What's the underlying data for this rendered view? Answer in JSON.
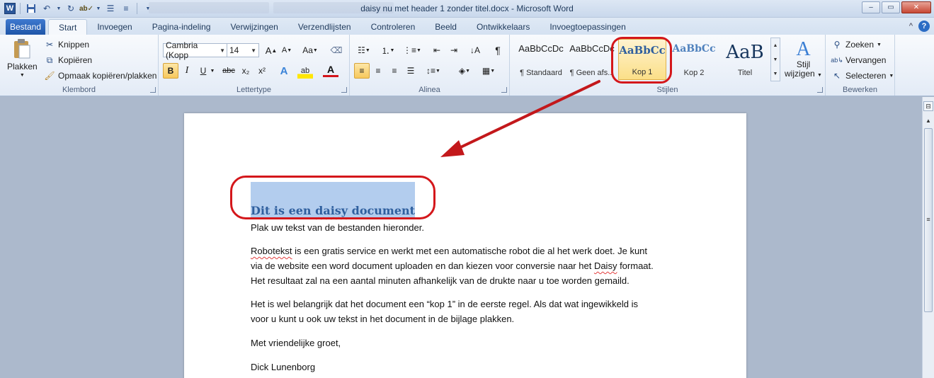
{
  "window": {
    "title": "daisy nu met header 1 zonder titel.docx  -  Microsoft Word",
    "min_symbol": "–",
    "max_symbol": "▭",
    "close_symbol": "✕"
  },
  "qat": {
    "logo": "W",
    "save_icon": "floppy-icon",
    "undo_icon": "undo-icon",
    "redo_icon": "redo-icon",
    "spell_icon": "spellcheck-icon"
  },
  "tabs": {
    "file": "Bestand",
    "items": [
      "Start",
      "Invoegen",
      "Pagina-indeling",
      "Verwijzingen",
      "Verzendlijsten",
      "Controleren",
      "Beeld",
      "Ontwikkelaars",
      "Invoegtoepassingen"
    ],
    "help": "?",
    "collapse": "^"
  },
  "clipboard": {
    "paste": "Plakken",
    "cut": "Knippen",
    "copy": "Kopiëren",
    "format_painter": "Opmaak kopiëren/plakken",
    "label": "Klembord"
  },
  "font": {
    "name": "Cambria (Kopp",
    "size": "14",
    "grow": "A",
    "shrink": "A",
    "case": "Aa",
    "bold": "B",
    "italic": "I",
    "underline": "U",
    "strike": "abc",
    "subscript": "x₂",
    "superscript": "x²",
    "effects": "A",
    "highlight": "ab",
    "color": "A",
    "label": "Lettertype"
  },
  "paragraph": {
    "pilcrow": "¶",
    "label": "Alinea"
  },
  "styles": {
    "items": [
      {
        "preview": "AaBbCcDc",
        "label": "¶ Standaard"
      },
      {
        "preview": "AaBbCcDc",
        "label": "¶ Geen afs..."
      },
      {
        "preview": "AaBbCc",
        "label": "Kop 1"
      },
      {
        "preview": "AaBbCc",
        "label": "Kop 2"
      },
      {
        "preview": "AaB",
        "label": "Titel"
      }
    ],
    "change_line1": "Stijl",
    "change_line2": "wijzigen",
    "label": "Stijlen"
  },
  "editing": {
    "find": "Zoeken",
    "replace": "Vervangen",
    "select": "Selecteren",
    "label": "Bewerken"
  },
  "document": {
    "heading": "Dit is een daisy document",
    "heading_pre": "Dit is een ",
    "heading_squig": "daisy",
    "heading_post": " document",
    "p1": "Plak uw tekst van de bestanden hieronder.",
    "p2_squig": "Robotekst",
    "p2_rest": " is een  gratis  service en werkt met een automatische robot die al het werk doet.  Je kunt",
    "p2_l2_pre": "via de website een word document uploaden  en dan kiezen voor conversie naar het ",
    "p2_l2_squig": "Daisy",
    "p2_l2_post": " formaat.",
    "p2_l3": "Het resultaat zal na een aantal minuten afhankelijk van de drukte naar u toe worden gemaild.",
    "p3_l1": "Het is wel belangrijk dat het document een “kop 1” in  de eerste  regel. Als dat wat ingewikkeld is",
    "p3_l2": "voor u kunt u ook uw tekst in het document in de bijlage plakken.",
    "p4": "Met vriendelijke groet,",
    "p5": "Dick Lunenborg"
  },
  "annotation": {
    "color": "#d4171b"
  }
}
